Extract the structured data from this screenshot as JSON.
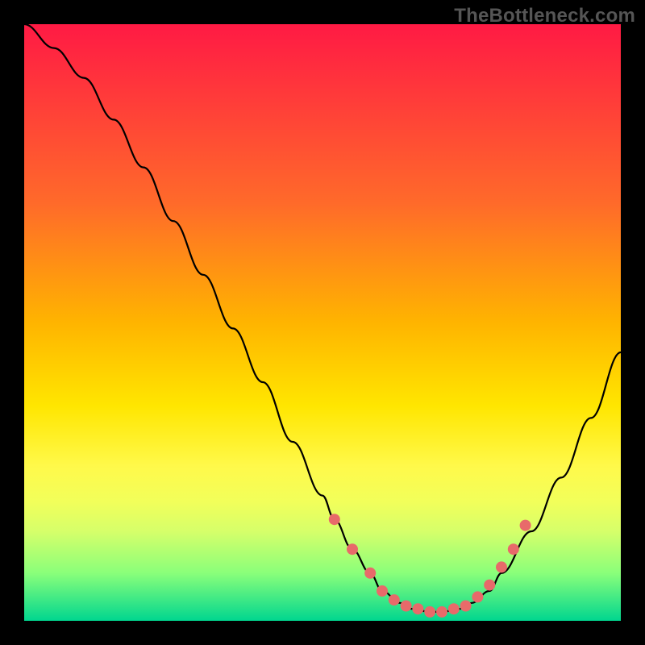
{
  "watermark": "TheBottleneck.com",
  "colors": {
    "background": "#000000",
    "gradient_top": "#ff1a44",
    "gradient_bottom": "#00d68f",
    "curve": "#000000",
    "marker": "#e86a6a"
  },
  "chart_data": {
    "type": "line",
    "title": "",
    "xlabel": "",
    "ylabel": "",
    "xlim": [
      0,
      100
    ],
    "ylim": [
      0,
      100
    ],
    "series": [
      {
        "name": "bottleneck-curve",
        "x": [
          0,
          5,
          10,
          15,
          20,
          25,
          30,
          35,
          40,
          45,
          50,
          52,
          55,
          58,
          60,
          63,
          65,
          68,
          70,
          73,
          75,
          78,
          80,
          85,
          90,
          95,
          100
        ],
        "y": [
          100,
          96,
          91,
          84,
          76,
          67,
          58,
          49,
          40,
          30,
          21,
          17,
          12,
          8,
          5,
          3,
          2,
          1.5,
          1.5,
          2,
          3,
          5,
          8,
          15,
          24,
          34,
          45
        ]
      }
    ],
    "markers": {
      "name": "highlight-points",
      "x": [
        52,
        55,
        58,
        60,
        62,
        64,
        66,
        68,
        70,
        72,
        74,
        76,
        78,
        80,
        82,
        84
      ],
      "y": [
        17,
        12,
        8,
        5,
        3.5,
        2.5,
        2,
        1.5,
        1.5,
        2,
        2.5,
        4,
        6,
        9,
        12,
        16
      ]
    }
  }
}
